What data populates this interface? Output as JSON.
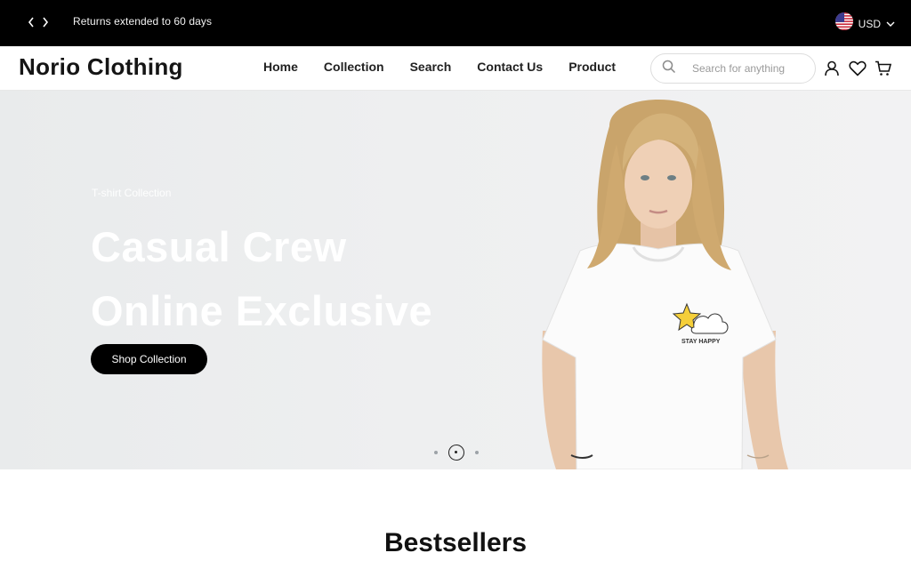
{
  "announcement": {
    "text": "Returns extended to 60 days",
    "prev_icon": "chevron-left-icon",
    "next_icon": "chevron-right-icon"
  },
  "currency": {
    "code": "USD",
    "flag_icon": "us-flag-icon"
  },
  "header": {
    "logo": "Norio Clothing",
    "nav": [
      {
        "label": "Home"
      },
      {
        "label": "Collection"
      },
      {
        "label": "Search"
      },
      {
        "label": "Contact Us"
      },
      {
        "label": "Product"
      }
    ],
    "search": {
      "placeholder": "Search for anything",
      "value": ""
    },
    "icons": [
      "account-icon",
      "wishlist-heart-icon",
      "cart-icon"
    ]
  },
  "hero": {
    "eyebrow": "T-shirt Collection",
    "headline_line1": "Casual Crew",
    "headline_line2": "Online Exclusive",
    "cta": "Shop Collection",
    "shirt_print": "STAY HAPPY",
    "slides_total": 3,
    "active_slide": 2
  },
  "bestsellers": {
    "title": "Bestsellers"
  },
  "colors": {
    "topbar_bg": "#000000",
    "cta_bg": "#000000",
    "hero_bg": "#eceeef"
  }
}
